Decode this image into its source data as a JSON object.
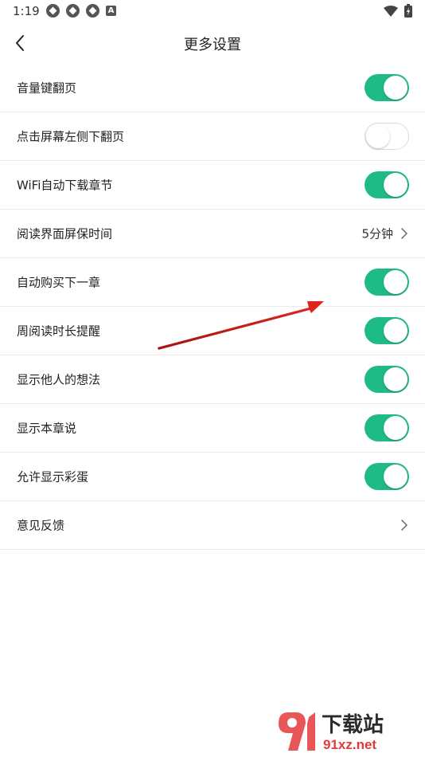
{
  "status_bar": {
    "time": "1:19",
    "notification_icons": [
      "gear-icon",
      "gear-icon",
      "gear-icon",
      "a-icon"
    ],
    "a_badge_text": "A",
    "right_icons": [
      "wifi-icon",
      "battery-icon"
    ]
  },
  "header": {
    "title": "更多设置",
    "back_icon": "chevron-left-icon"
  },
  "settings": [
    {
      "label": "音量键翻页",
      "type": "toggle",
      "on": true
    },
    {
      "label": "点击屏幕左侧下翻页",
      "type": "toggle",
      "on": false
    },
    {
      "label": "WiFi自动下载章节",
      "type": "toggle",
      "on": true
    },
    {
      "label": "阅读界面屏保时间",
      "type": "link",
      "value": "5分钟"
    },
    {
      "label": "自动购买下一章",
      "type": "toggle",
      "on": true
    },
    {
      "label": "周阅读时长提醒",
      "type": "toggle",
      "on": true
    },
    {
      "label": "显示他人的想法",
      "type": "toggle",
      "on": true
    },
    {
      "label": "显示本章说",
      "type": "toggle",
      "on": true
    },
    {
      "label": "允许显示彩蛋",
      "type": "toggle",
      "on": true
    },
    {
      "label": "意见反馈",
      "type": "link",
      "value": ""
    }
  ],
  "colors": {
    "toggle_on": "#1fbb86",
    "toggle_off_border": "#dcdcdc",
    "divider": "#ececec",
    "annotation_arrow": "#d9221c"
  },
  "watermark": {
    "text_top": "下载站",
    "text_bottom": "91xz.net"
  }
}
